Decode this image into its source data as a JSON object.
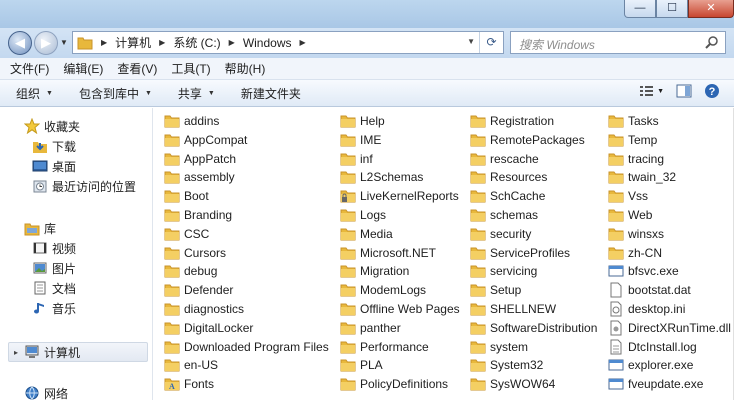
{
  "window": {
    "controls": {
      "minimize": "—",
      "maximize": "☐",
      "close": "✕"
    }
  },
  "address": {
    "segments": [
      "计算机",
      "系统 (C:)",
      "Windows"
    ],
    "search_placeholder": "搜索 Windows"
  },
  "menu": [
    "文件(F)",
    "编辑(E)",
    "查看(V)",
    "工具(T)",
    "帮助(H)"
  ],
  "toolbar": {
    "organize": "组织",
    "include_in_library": "包含到库中",
    "share": "共享",
    "new_folder": "新建文件夹"
  },
  "nav": {
    "favorites": "收藏夹",
    "downloads": "下载",
    "desktop": "桌面",
    "recent": "最近访问的位置",
    "libraries": "库",
    "videos": "视频",
    "pictures": "图片",
    "documents": "文档",
    "music": "音乐",
    "computer": "计算机",
    "network": "网络"
  },
  "files": {
    "col1": [
      "addins",
      "AppCompat",
      "AppPatch",
      "assembly",
      "Boot",
      "Branding",
      "CSC",
      "Cursors",
      "debug",
      "Defender",
      "diagnostics",
      "DigitalLocker",
      "Downloaded Program Files",
      "en-US",
      "Fonts"
    ],
    "col2": [
      "Help",
      "IME",
      "inf",
      "L2Schemas",
      "LiveKernelReports",
      "Logs",
      "Media",
      "Microsoft.NET",
      "Migration",
      "ModemLogs",
      "Offline Web Pages",
      "panther",
      "Performance",
      "PLA",
      "PolicyDefinitions"
    ],
    "col3": [
      "Registration",
      "RemotePackages",
      "rescache",
      "Resources",
      "SchCache",
      "schemas",
      "security",
      "ServiceProfiles",
      "servicing",
      "Setup",
      "SHELLNEW",
      "SoftwareDistribution",
      "system",
      "System32",
      "SysWOW64"
    ],
    "col4": [
      "Tasks",
      "Temp",
      "tracing",
      "twain_32",
      "Vss",
      "Web",
      "winsxs",
      "zh-CN",
      "bfsvc.exe",
      "bootstat.dat",
      "desktop.ini",
      "DirectXRunTime.dll",
      "DtcInstall.log",
      "explorer.exe",
      "fveupdate.exe"
    ],
    "col4_icons": [
      "folder",
      "folder",
      "folder",
      "folder",
      "folder",
      "folder",
      "folder",
      "folder",
      "exe",
      "file",
      "ini",
      "dll",
      "log",
      "exe",
      "exe"
    ],
    "col1_icons": [
      "folder",
      "folder",
      "folder",
      "folder",
      "folder",
      "folder",
      "folder",
      "folder",
      "folder",
      "folder",
      "folder",
      "folder",
      "folder",
      "folder",
      "fontfolder"
    ],
    "col2_icons": [
      "folder",
      "folder",
      "folder",
      "folder",
      "lockfolder",
      "folder",
      "folder",
      "folder",
      "folder",
      "folder",
      "folder",
      "folder",
      "folder",
      "folder",
      "folder"
    ],
    "col3_icons": [
      "folder",
      "folder",
      "folder",
      "folder",
      "folder",
      "folder",
      "folder",
      "folder",
      "folder",
      "folder",
      "folder",
      "folder",
      "folder",
      "folder",
      "folder"
    ]
  },
  "colors": {
    "folder": "#e8b83c",
    "folder_dark": "#c9932a",
    "accent": "#3b6ea5"
  }
}
